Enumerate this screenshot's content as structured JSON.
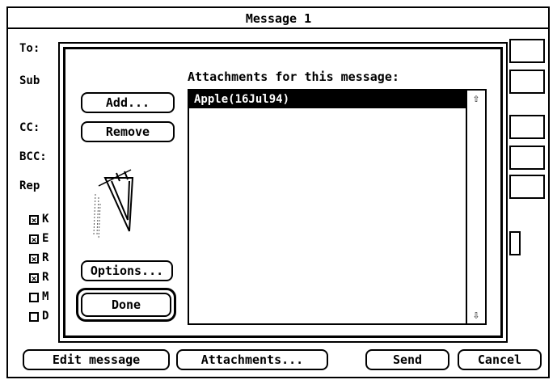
{
  "window": {
    "title": "Message 1"
  },
  "form": {
    "to_label": "To:",
    "subject_label": "Sub",
    "cc_label": "CC:",
    "bcc_label": "BCC:",
    "reply_label": "Rep"
  },
  "checkboxes": [
    {
      "label": "K",
      "checked": true
    },
    {
      "label": "E",
      "checked": true
    },
    {
      "label": "R",
      "checked": true
    },
    {
      "label": "R",
      "checked": true
    },
    {
      "label": "M",
      "checked": false
    },
    {
      "label": "D",
      "checked": false
    }
  ],
  "dialog": {
    "heading": "Attachments for this message:",
    "add_label": "Add...",
    "remove_label": "Remove",
    "options_label": "Options...",
    "done_label": "Done",
    "attachments": [
      "Apple(16Jul94)"
    ],
    "icon": "paperclip-icon"
  },
  "bottom_bar": {
    "edit_label": "Edit message",
    "attachments_label": "Attachments...",
    "send_label": "Send",
    "cancel_label": "Cancel"
  }
}
